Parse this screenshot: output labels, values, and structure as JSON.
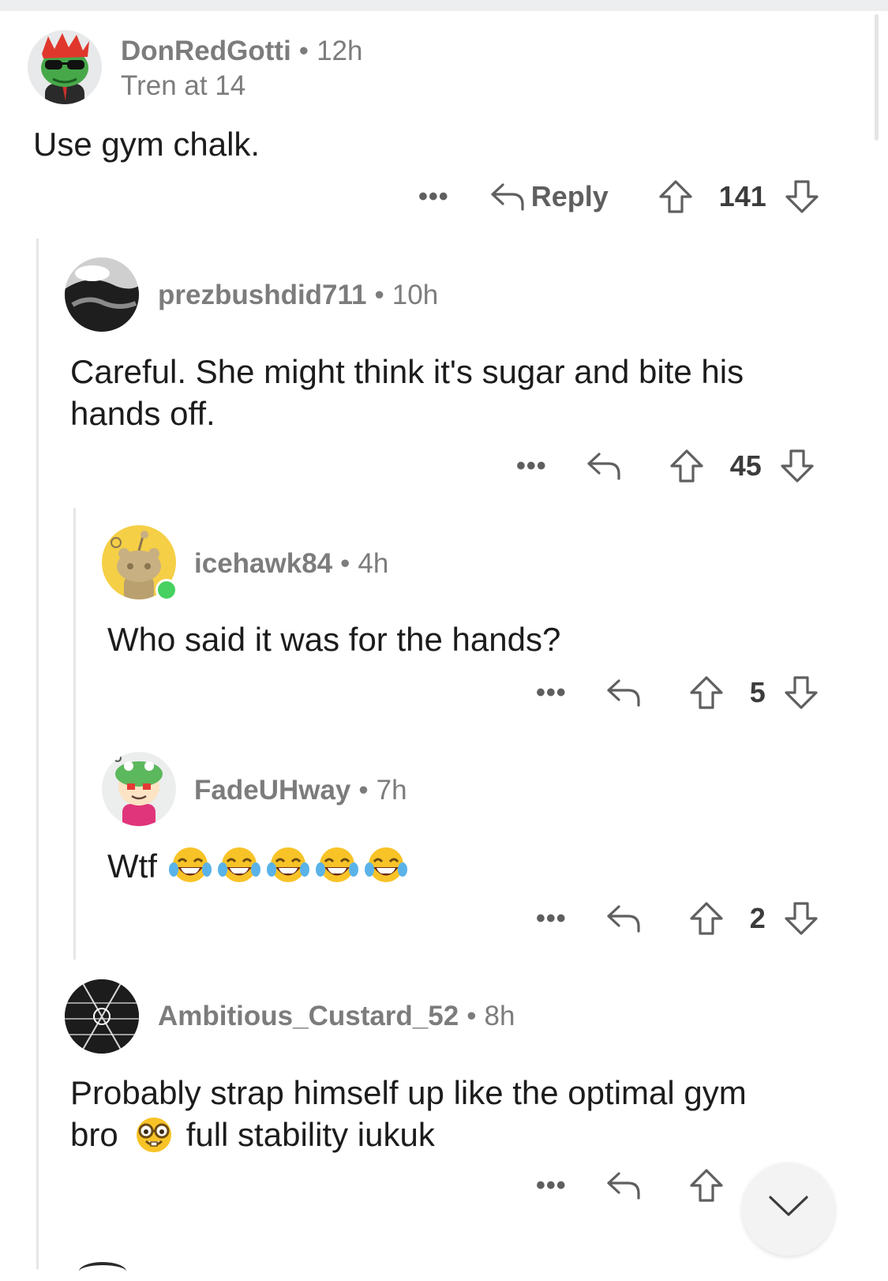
{
  "comments": [
    {
      "username": "DonRedGotti",
      "time": "12h",
      "flair": "Tren at 14",
      "body": "Use gym chalk.",
      "reply_label": "Reply",
      "score": "141",
      "more": "•••"
    },
    {
      "username": "prezbushdid711",
      "time": "10h",
      "body_lines": [
        "Careful. She might think it's sugar and bite his",
        "hands off."
      ],
      "score": "45",
      "more": "•••"
    },
    {
      "username": "icehawk84",
      "time": "4h",
      "body": "Who said it was for the hands?",
      "score": "5",
      "more": "•••"
    },
    {
      "username": "FadeUHway",
      "time": "7h",
      "body": "Wtf",
      "emoji": [
        "face-with-tears-of-joy",
        "face-with-tears-of-joy",
        "face-with-tears-of-joy",
        "face-with-tears-of-joy",
        "face-with-tears-of-joy"
      ],
      "score": "2",
      "more": "•••"
    },
    {
      "username": "Ambitious_Custard_52",
      "time": "8h",
      "body_lines": [
        "Probably strap himself up like the optimal gym",
        "full stability iukuk"
      ],
      "body_prefix": "bro",
      "emoji": [
        "nerd-face"
      ],
      "more": "•••"
    }
  ],
  "separator": "•",
  "icons": [
    "reply-arrow-icon",
    "upvote-arrow-icon",
    "downvote-arrow-icon",
    "chevron-down-icon"
  ],
  "colors": {
    "text": "#1c1c1c",
    "meta": "#7c7c7c",
    "thread_line": "#e6e6e8",
    "online": "#46d160"
  }
}
